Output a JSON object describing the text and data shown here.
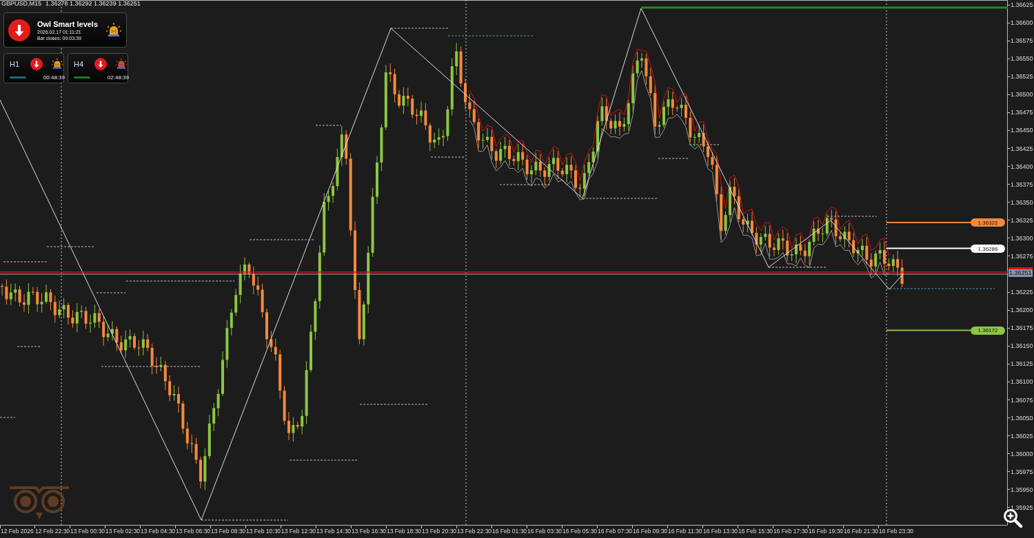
{
  "chart_header": {
    "symbol": "GBPUSD,M15",
    "prices": [
      "1.36278",
      "1.36292",
      "1.36239",
      "1.36251"
    ]
  },
  "signal_panel": {
    "title": "Owl Smart levels",
    "datetime": "2026.02.17 01:11:21",
    "bar_closes": "Bar closes: 00:03:39"
  },
  "timeframes": [
    {
      "label": "H1",
      "alarm": {
        "color": "#e8a317"
      },
      "trend_bar": {
        "color": "#1d6b78"
      },
      "time": "00:48:39"
    },
    {
      "label": "H4",
      "alarm": {
        "color": "#d9542b"
      },
      "trend_bar": {
        "color": "#1f7a1f"
      },
      "time": "02:48:39"
    }
  ],
  "level_labels": [
    {
      "price": "1.36322",
      "color": "#f7893b"
    },
    {
      "price": "1.36286",
      "color": "#ffffff"
    },
    {
      "price": "1.36172",
      "color": "#8cc63f"
    }
  ],
  "current_price": "1.36251",
  "price_axis": [
    "1.36625",
    "1.36600",
    "1.36575",
    "1.36550",
    "1.36525",
    "1.36500",
    "1.36475",
    "1.36450",
    "1.36425",
    "1.36400",
    "1.36375",
    "1.36350",
    "1.36325",
    "1.36300",
    "1.36275",
    "1.36225",
    "1.36200",
    "1.36175",
    "1.36150",
    "1.36125",
    "1.36100",
    "1.36075",
    "1.36050",
    "1.36025",
    "1.36000",
    "1.35975",
    "1.35950",
    "1.35925"
  ],
  "time_axis": [
    "12 Feb 2026",
    "12 Feb 22:30",
    "13 Feb 00:30",
    "13 Feb 02:30",
    "13 Feb 04:30",
    "13 Feb 06:30",
    "13 Feb 08:30",
    "13 Feb 10:30",
    "13 Feb 12:30",
    "13 Feb 14:30",
    "13 Feb 16:30",
    "13 Feb 18:30",
    "13 Feb 20:30",
    "13 Feb 22:30",
    "16 Feb 01:30",
    "16 Feb 03:30",
    "16 Feb 05:30",
    "16 Feb 07:30",
    "16 Feb 09:30",
    "16 Feb 11:30",
    "16 Feb 13:30",
    "16 Feb 15:30",
    "16 Feb 17:30",
    "16 Feb 19:30",
    "16 Feb 21:30",
    "16 Feb 23:30"
  ]
}
